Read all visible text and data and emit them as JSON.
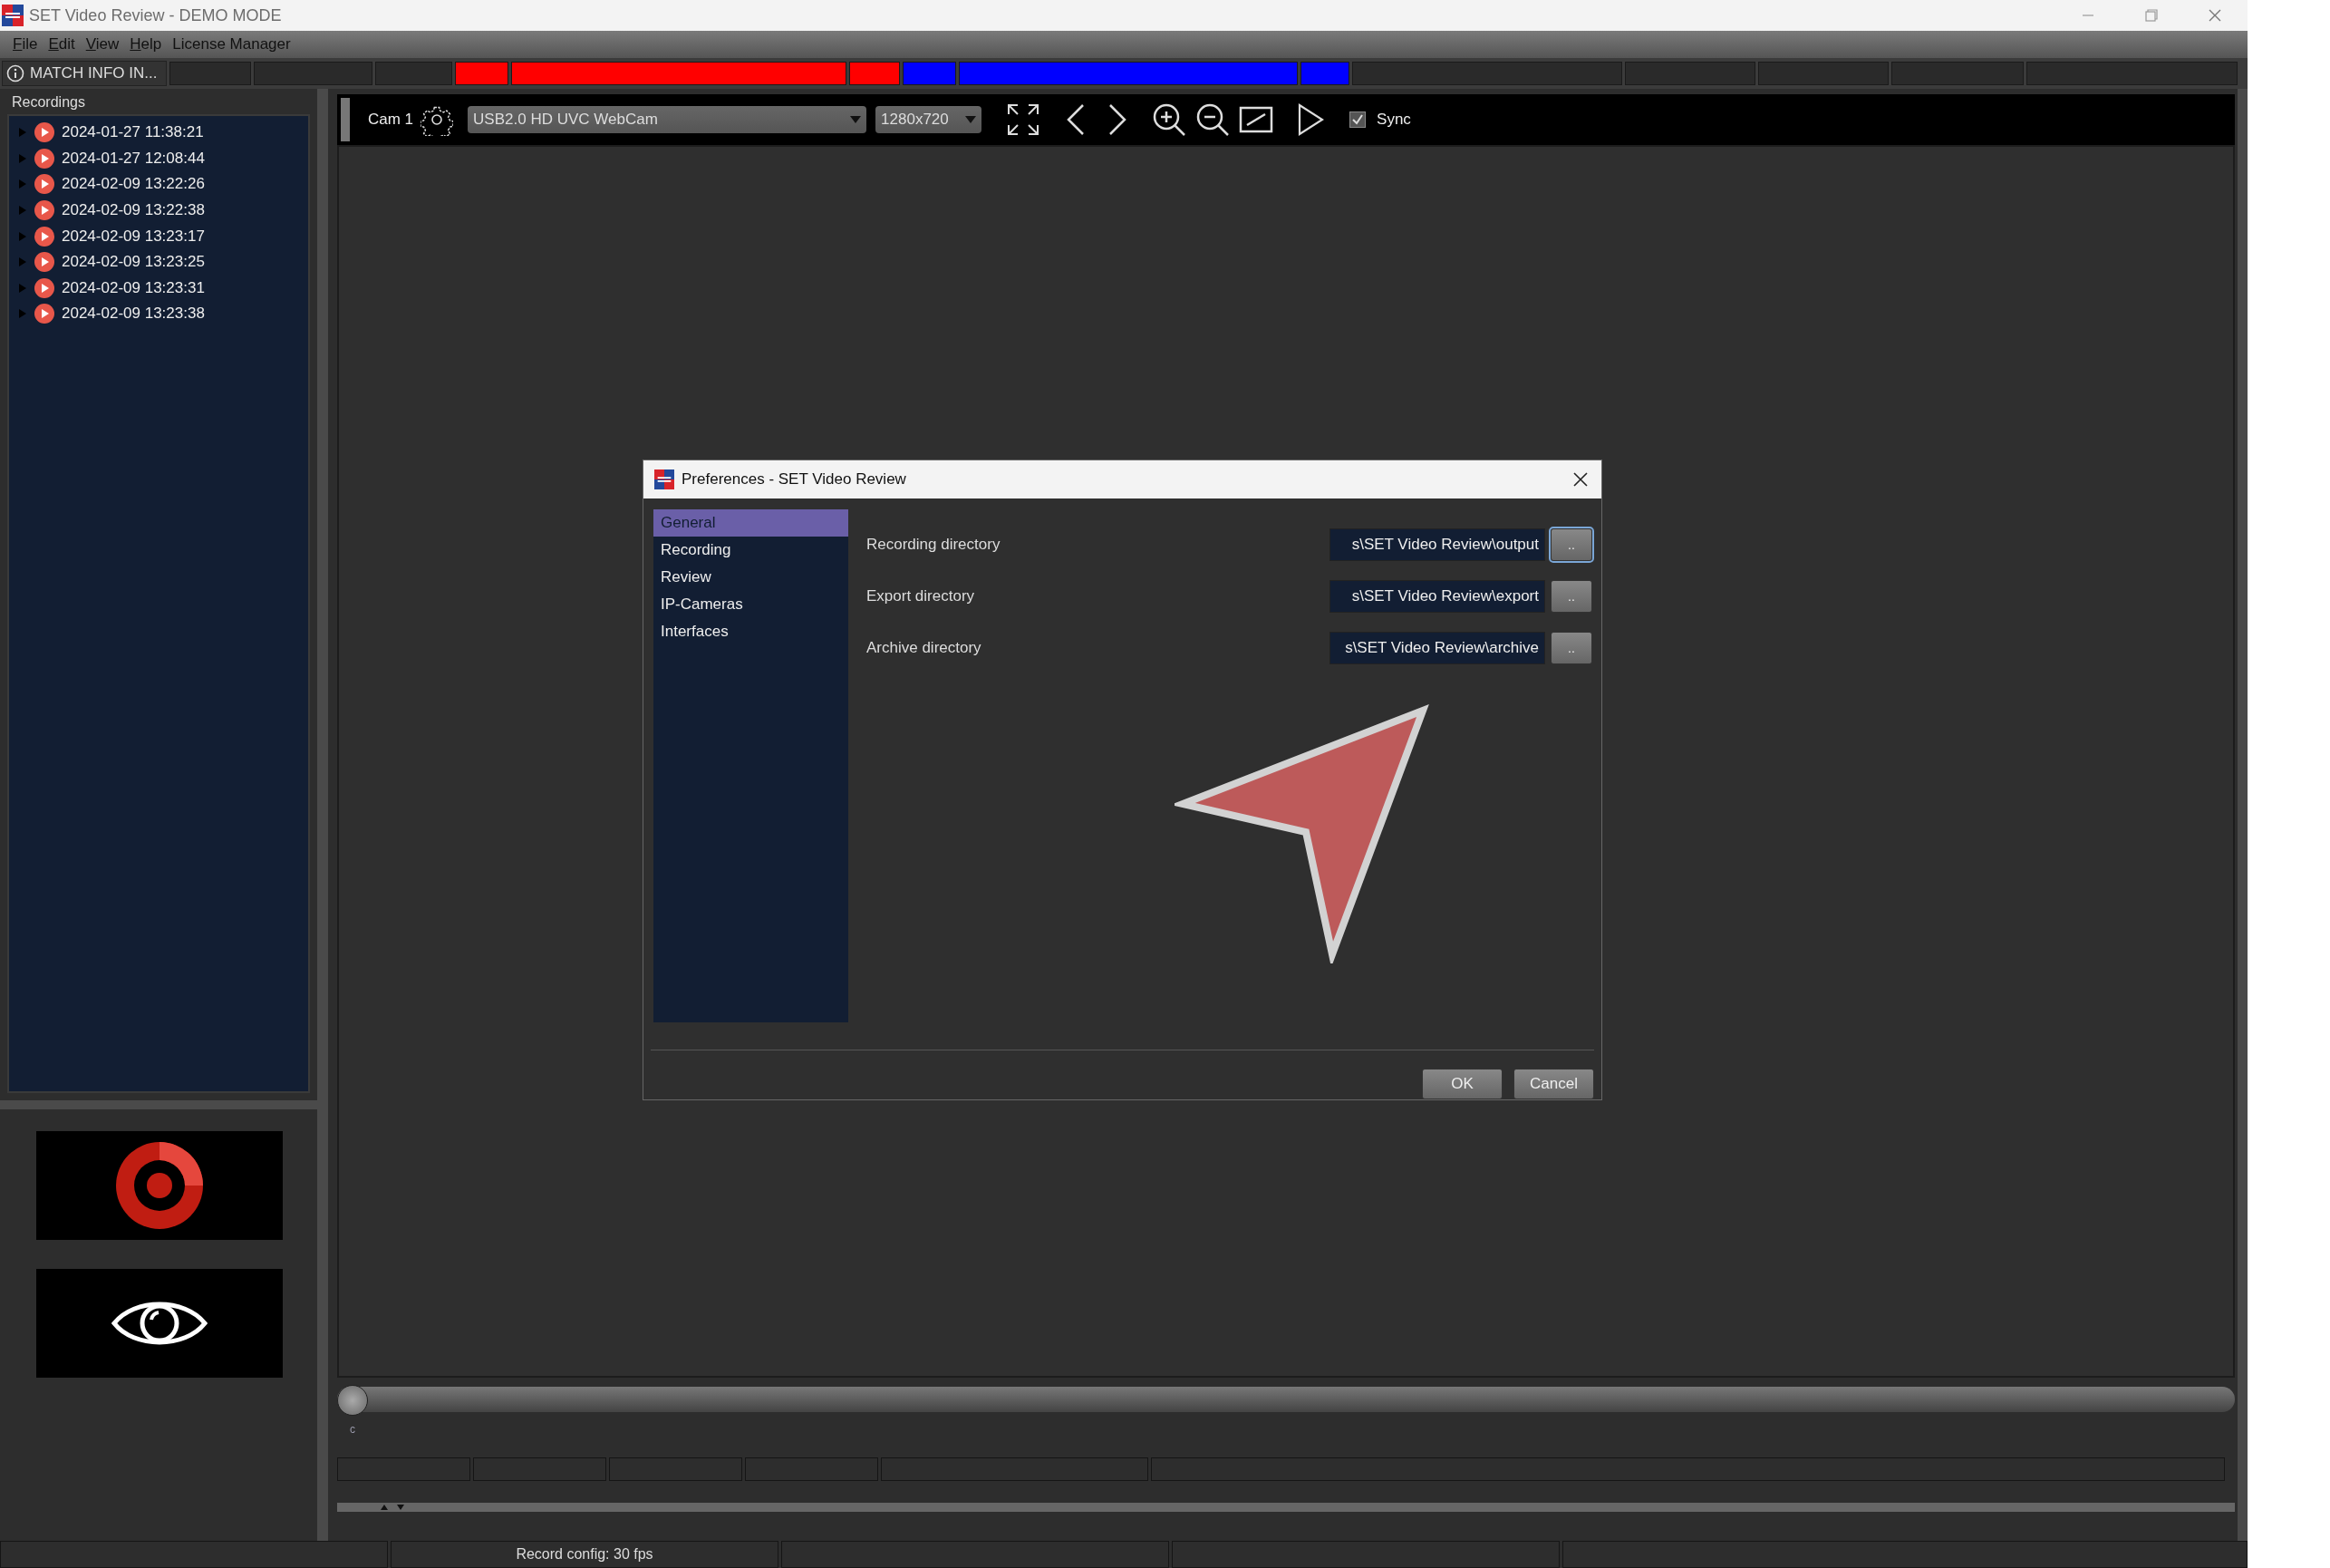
{
  "window": {
    "title": "SET Video Review - DEMO MODE"
  },
  "menu": [
    {
      "label": "File",
      "accelerator": true
    },
    {
      "label": "Edit",
      "accelerator": true
    },
    {
      "label": "View",
      "accelerator": true
    },
    {
      "label": "Help",
      "accelerator": true
    },
    {
      "label": "License Manager",
      "accelerator": false
    }
  ],
  "info_bar": {
    "label": "MATCH INFO IN...",
    "segments": [
      {
        "color": "#2a2a2a"
      },
      {
        "color": "#2a2a2a"
      },
      {
        "color": "#2a2a2a"
      },
      {
        "color": "#ff0000"
      },
      {
        "color": "#ff0000"
      },
      {
        "color": "#ff0000"
      },
      {
        "color": "#0000ff"
      },
      {
        "color": "#0000ff"
      },
      {
        "color": "#0000ff"
      },
      {
        "color": "#2a2a2a"
      },
      {
        "color": "#2a2a2a"
      },
      {
        "color": "#2a2a2a"
      },
      {
        "color": "#2a2a2a"
      },
      {
        "color": "#2a2a2a"
      }
    ]
  },
  "recordings": {
    "title": "Recordings",
    "items": [
      {
        "label": "2024-01-27 11:38:21",
        "expanded": false
      },
      {
        "label": "2024-01-27 12:08:44",
        "expanded": false
      },
      {
        "label": "2024-02-09 13:22:26",
        "expanded": false
      },
      {
        "label": "2024-02-09 13:22:38",
        "expanded": false
      },
      {
        "label": "2024-02-09 13:23:17",
        "expanded": false
      },
      {
        "label": "2024-02-09 13:23:25",
        "expanded": false
      },
      {
        "label": "2024-02-09 13:23:31",
        "expanded": false
      },
      {
        "label": "2024-02-09 13:23:38",
        "expanded": false
      }
    ]
  },
  "toolbar": {
    "camera": "Cam 1",
    "device": "USB2.0 HD UVC WebCam",
    "resolution": "1280x720",
    "sync": {
      "label": "Sync",
      "checked": true
    }
  },
  "timeline": {
    "level": 0,
    "marker": "c"
  },
  "dialog": {
    "title": "Preferences - SET Video Review",
    "nav": [
      {
        "label": "General",
        "selected": true
      },
      {
        "label": "Recording",
        "selected": false
      },
      {
        "label": "Review",
        "selected": false
      },
      {
        "label": "IP-Cameras",
        "selected": false
      },
      {
        "label": "Interfaces",
        "selected": false
      }
    ],
    "rows": [
      {
        "label": "Recording directory",
        "value": "s\\SET Video Review\\output",
        "button": "..",
        "focused": true
      },
      {
        "label": "Export directory",
        "value": "s\\SET Video Review\\export",
        "button": "..",
        "focused": false
      },
      {
        "label": "Archive directory",
        "value": "s\\SET Video Review\\archive",
        "button": "..",
        "focused": false
      }
    ],
    "buttons": [
      "OK",
      "Cancel"
    ]
  },
  "status_bar": {
    "record_config": "Record config: 30 fps"
  }
}
